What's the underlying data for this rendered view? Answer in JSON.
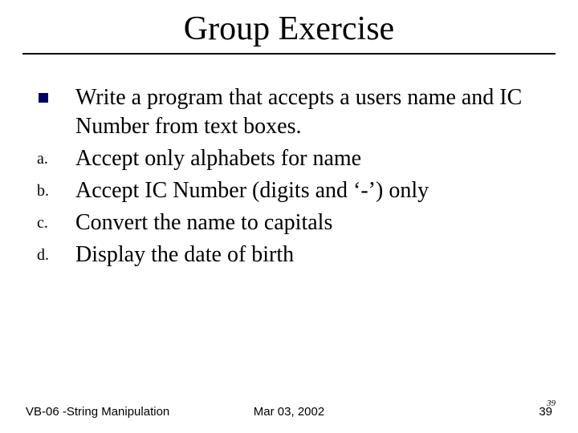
{
  "title": "Group Exercise",
  "bullet": {
    "text": "Write a program that accepts a users name and IC Number from text boxes."
  },
  "items": [
    {
      "marker": "a.",
      "text": "Accept only alphabets for name"
    },
    {
      "marker": "b.",
      "text": "Accept IC Number (digits and ‘-’) only"
    },
    {
      "marker": "c.",
      "text": "Convert the name to capitals"
    },
    {
      "marker": "d.",
      "text": "Display the date of birth"
    }
  ],
  "footer": {
    "left": "VB-06 -String Manipulation",
    "center": "Mar 03, 2002",
    "page": "39",
    "page_overlay": "39"
  }
}
